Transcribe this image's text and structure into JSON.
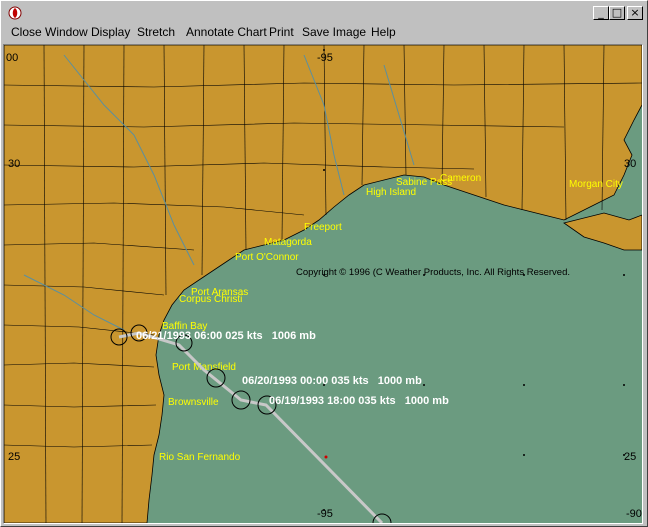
{
  "window": {
    "title": ""
  },
  "menu": [
    {
      "label": "Close Window"
    },
    {
      "label": "Display"
    },
    {
      "label": "Stretch"
    },
    {
      "label": "Annotate Chart"
    },
    {
      "label": "Print"
    },
    {
      "label": "Save Image"
    },
    {
      "label": "Help"
    }
  ],
  "grid_labels": {
    "lon_top_left": "00",
    "lon_top": "-95",
    "lat_30_left": "30",
    "lat_30_right": "30",
    "lat_25_left": "25",
    "lat_25_right": "25",
    "lon_bottom": "-95",
    "lon_bottom_right": "-90"
  },
  "copyright": "Copyright © 1996 (C Weather Products, Inc. All Rights Reserved.",
  "places": [
    "Sabine Pass",
    "Cameron",
    "Morgan City",
    "High Island",
    "Freeport",
    "Matagorda",
    "Port O'Connor",
    "Port Aransas",
    "Corpus Christi",
    "Baffin Bay",
    "Port Mansfield",
    "Brownsville",
    "Rio San Fernando"
  ],
  "storm_track": [
    {
      "label": "06/21/1993 06:00 025 kts   1006 mb"
    },
    {
      "label": "06/20/1993 00:00 035 kts   1000 mb"
    },
    {
      "label": "06/19/1993 18:00 035 kts   1000 mb"
    }
  ],
  "colors": {
    "land": "#c9962f",
    "water": "#6b9b80",
    "label": "#ffff00",
    "track": "#c8c8c8"
  },
  "icons": {
    "app": "weather-app-icon",
    "minimize": "minimize-icon",
    "maximize": "maximize-icon",
    "close": "close-icon"
  }
}
